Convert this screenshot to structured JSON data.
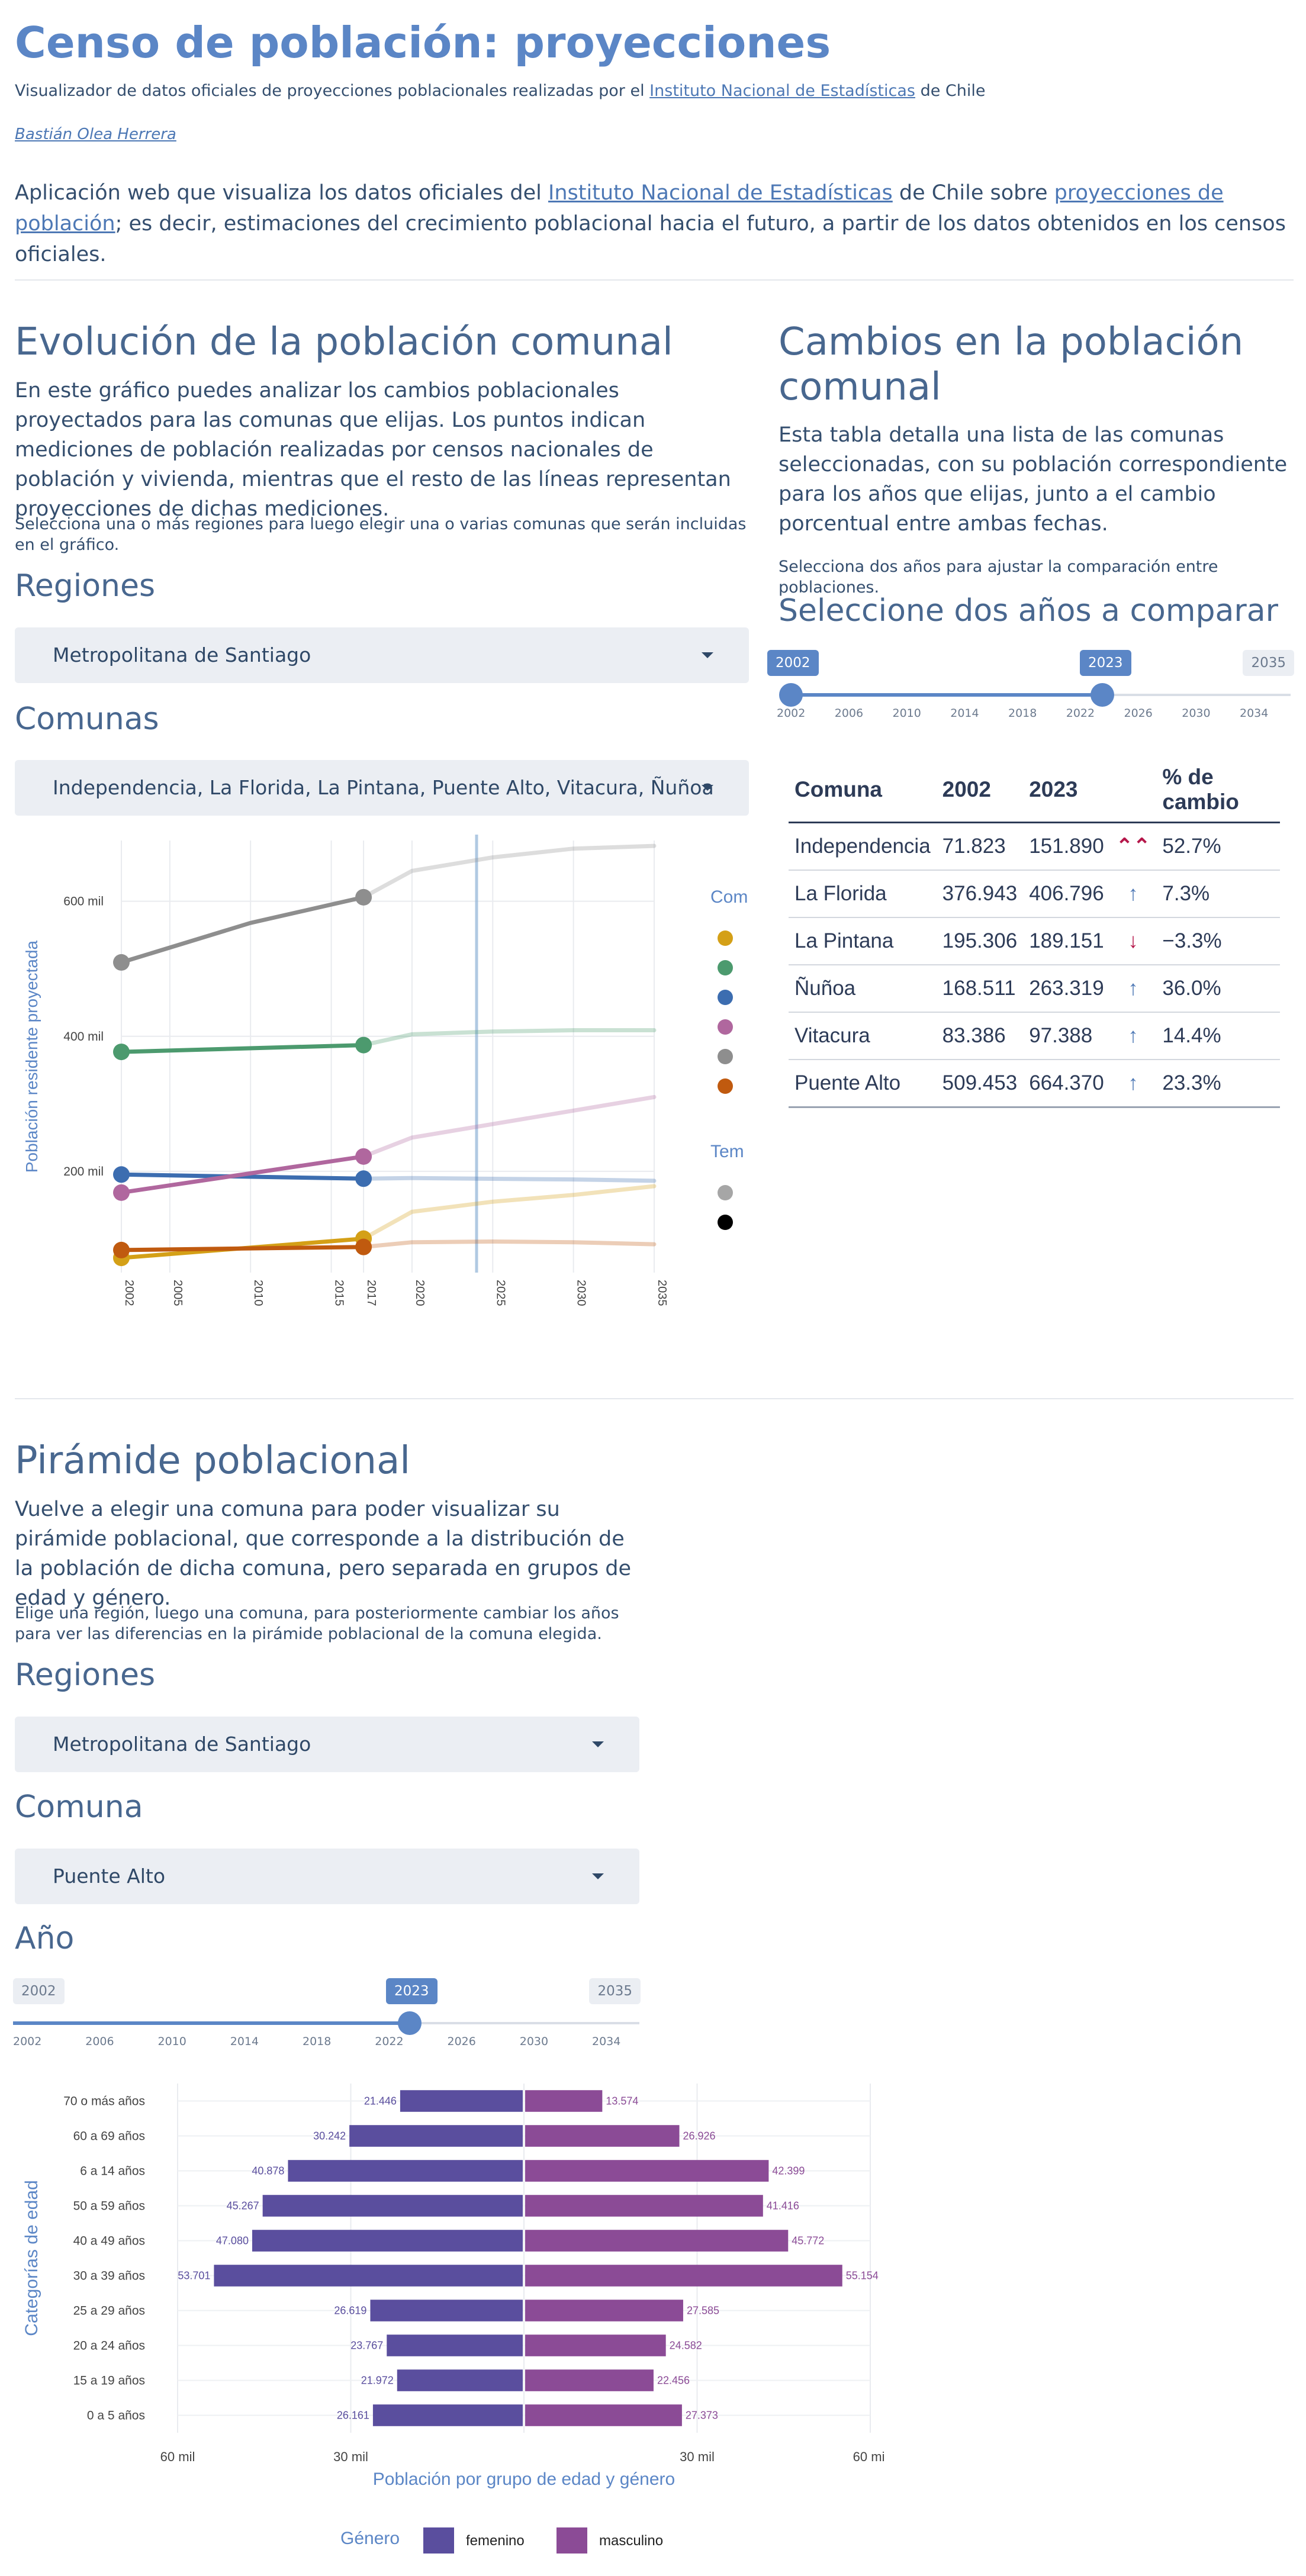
{
  "header": {
    "title": "Censo de población: proyecciones",
    "subtitle_pre": "Visualizador de datos oficiales de proyecciones poblacionales realizadas por el ",
    "subtitle_link": "Instituto Nacional de Estadísticas",
    "subtitle_post": " de Chile",
    "author": "Bastián Olea Herrera",
    "intro_1": "Aplicación web que visualiza los datos oficiales del ",
    "intro_link1": "Instituto Nacional de Estadísticas",
    "intro_2": " de Chile sobre ",
    "intro_link2": "proyecciones de población",
    "intro_3": "; es decir, estimaciones del crecimiento poblacional hacia el futuro, a partir de los datos obtenidos en los censos oficiales."
  },
  "evolucion": {
    "title": "Evolución de la población comunal",
    "lead": "En este gráfico puedes analizar los cambios poblacionales proyectados para las comunas que elijas. Los puntos indican mediciones de población realizadas por censos nacionales de población y vivienda, mientras que el resto de las líneas representan proyecciones de dichas mediciones.",
    "hint": "Selecciona una o más regiones para luego elegir una o varias comunas que serán incluidas en el gráfico.",
    "regiones_label": "Regiones",
    "regiones_value": "Metropolitana de Santiago",
    "comunas_label": "Comunas",
    "comunas_value": "Independencia, La Florida, La Pintana, Puente Alto, Vitacura, Ñuñoa"
  },
  "cambios": {
    "title": "Cambios en la población comunal",
    "lead": "Esta tabla detalla una lista de las comunas seleccionadas, con su población correspondiente para los años que elijas, junto a el cambio porcentual entre ambas fechas.",
    "hint": "Selecciona dos años para ajustar la comparación entre poblaciones.",
    "slider_label": "Seleccione dos años a comparar",
    "slider_min": "2002",
    "slider_max": "2035",
    "slider_from": "2023",
    "slider_from_left": "2002",
    "slider_ticks": [
      "2002",
      "2006",
      "2010",
      "2014",
      "2018",
      "2022",
      "2026",
      "2030",
      "2034"
    ],
    "table_headers": [
      "Comuna",
      "2002",
      "2023",
      "",
      "% de cambio"
    ],
    "rows": [
      {
        "comuna": "Independencia",
        "a": "71.823",
        "b": "151.890",
        "arrow": "⌃⌃",
        "arrow_color": "#b5174a",
        "pct": "52.7%"
      },
      {
        "comuna": "La Florida",
        "a": "376.943",
        "b": "406.796",
        "arrow": "↑",
        "arrow_color": "#4d78b5",
        "pct": "7.3%"
      },
      {
        "comuna": "La Pintana",
        "a": "195.306",
        "b": "189.151",
        "arrow": "↓",
        "arrow_color": "#b5174a",
        "pct": "−3.3%"
      },
      {
        "comuna": "Ñuñoa",
        "a": "168.511",
        "b": "263.319",
        "arrow": "↑",
        "arrow_color": "#4d78b5",
        "pct": "36.0%"
      },
      {
        "comuna": "Vitacura",
        "a": "83.386",
        "b": "97.388",
        "arrow": "↑",
        "arrow_color": "#4d78b5",
        "pct": "14.4%"
      },
      {
        "comuna": "Puente Alto",
        "a": "509.453",
        "b": "664.370",
        "arrow": "↑",
        "arrow_color": "#4d78b5",
        "pct": "23.3%"
      }
    ]
  },
  "piramide": {
    "title": "Pirámide poblacional",
    "lead": "Vuelve a elegir una comuna para poder visualizar su pirámide poblacional, que corresponde a la distribución de la población de dicha comuna, pero separada en grupos de edad y género.",
    "hint": "Elige una región, luego una comuna, para posteriormente cambiar los años para ver las diferencias en la pirámide poblacional de la comuna elegida.",
    "regiones_label": "Regiones",
    "regiones_value": "Metropolitana de Santiago",
    "comuna_label": "Comuna",
    "comuna_value": "Puente Alto",
    "anio_label": "Año",
    "slider_min": "2002",
    "slider_max": "2035",
    "slider_value": "2023",
    "slider_ticks": [
      "2002",
      "2006",
      "2010",
      "2014",
      "2018",
      "2022",
      "2026",
      "2030",
      "2034"
    ]
  },
  "chart_data": [
    {
      "type": "line",
      "ylabel": "Población residente proyectada",
      "xlabel": "",
      "x": [
        2002,
        2005,
        2010,
        2015,
        2017,
        2020,
        2025,
        2030,
        2035
      ],
      "x_ticks": [
        "2002",
        "2005",
        "2010",
        "2015",
        "2017",
        "2020",
        "2025",
        "2030",
        "2035"
      ],
      "y_ticks": [
        "200 mil",
        "400 mil",
        "600 mil"
      ],
      "y_tick_values": [
        200000,
        400000,
        600000
      ],
      "ylim": [
        50000,
        690000
      ],
      "xlim": [
        2002,
        2035
      ],
      "current_year_marker": 2024,
      "legend_title_1": "Com",
      "legend_title_2": "Tem",
      "series": [
        {
          "color": "#d4a017",
          "points": [
            [
              2002,
              71823
            ],
            [
              2017,
              100281
            ],
            [
              2020,
              140000
            ],
            [
              2025,
              155000
            ],
            [
              2030,
              165000
            ],
            [
              2035,
              178000
            ]
          ],
          "census": [
            [
              2002,
              71823
            ],
            [
              2017,
              100281
            ]
          ]
        },
        {
          "color": "#4c9a6e",
          "points": [
            [
              2002,
              376943
            ],
            [
              2017,
              387000
            ],
            [
              2020,
              403000
            ],
            [
              2025,
              407000
            ],
            [
              2030,
              409000
            ],
            [
              2035,
              409000
            ]
          ],
          "census": [
            [
              2002,
              376943
            ],
            [
              2017,
              387000
            ]
          ]
        },
        {
          "color": "#3c6db0",
          "points": [
            [
              2002,
              195306
            ],
            [
              2017,
              189151
            ],
            [
              2020,
              190000
            ],
            [
              2025,
              189000
            ],
            [
              2030,
              188000
            ],
            [
              2035,
              186000
            ]
          ],
          "census": [
            [
              2002,
              195306
            ],
            [
              2017,
              189151
            ]
          ]
        },
        {
          "color": "#b0679e",
          "points": [
            [
              2002,
              168511
            ],
            [
              2017,
              222000
            ],
            [
              2020,
              250000
            ],
            [
              2025,
              270000
            ],
            [
              2030,
              290000
            ],
            [
              2035,
              310000
            ]
          ],
          "census": [
            [
              2002,
              168511
            ],
            [
              2017,
              222000
            ]
          ]
        },
        {
          "color": "#8e8e8e",
          "points": [
            [
              2002,
              509453
            ],
            [
              2010,
              568000
            ],
            [
              2017,
              606000
            ],
            [
              2020,
              645000
            ],
            [
              2025,
              665000
            ],
            [
              2030,
              678000
            ],
            [
              2035,
              682000
            ]
          ],
          "census": [
            [
              2002,
              509453
            ],
            [
              2017,
              606000
            ]
          ]
        },
        {
          "color": "#c05a0f",
          "points": [
            [
              2002,
              83386
            ],
            [
              2017,
              88000
            ],
            [
              2020,
              95000
            ],
            [
              2025,
              96000
            ],
            [
              2030,
              95000
            ],
            [
              2035,
              92000
            ]
          ],
          "census": [
            [
              2002,
              83386
            ],
            [
              2017,
              88000
            ]
          ]
        }
      ],
      "legend_temporal_colors": [
        "#a6a6a6",
        "#000000"
      ]
    },
    {
      "type": "bar",
      "xlabel": "Población por grupo de edad y género",
      "ylabel": "Categorías de edad",
      "legend_title": "Género",
      "x_ticks": [
        "60 mil",
        "30 mil",
        "30 mil",
        "60 mil"
      ],
      "xlim": [
        -60000,
        60000
      ],
      "categories": [
        "70 o más años",
        "60 a 69 años",
        "6 a 14 años",
        "50 a 59 años",
        "40 a 49 años",
        "30 a 39 años",
        "25 a 29 años",
        "20 a 24 años",
        "15 a 19 años",
        "0 a 5 años"
      ],
      "series": [
        {
          "name": "femenino",
          "color": "#5a4e9e",
          "values": [
            21446,
            30242,
            40878,
            45267,
            47080,
            53701,
            26619,
            23767,
            21972,
            26161
          ],
          "labels": [
            "21.446",
            "30.242",
            "40.878",
            "45.267",
            "47.080",
            "53.701",
            "26.619",
            "23.767",
            "21.972",
            "26.161"
          ]
        },
        {
          "name": "masculino",
          "color": "#8b4b96",
          "values": [
            13574,
            26926,
            42399,
            41416,
            45772,
            55154,
            27585,
            24582,
            22456,
            27373
          ],
          "labels": [
            "13.574",
            "26.926",
            "42.399",
            "41.416",
            "45.772",
            "55.154",
            "27.585",
            "24.582",
            "22.456",
            "27.373"
          ]
        }
      ]
    }
  ]
}
